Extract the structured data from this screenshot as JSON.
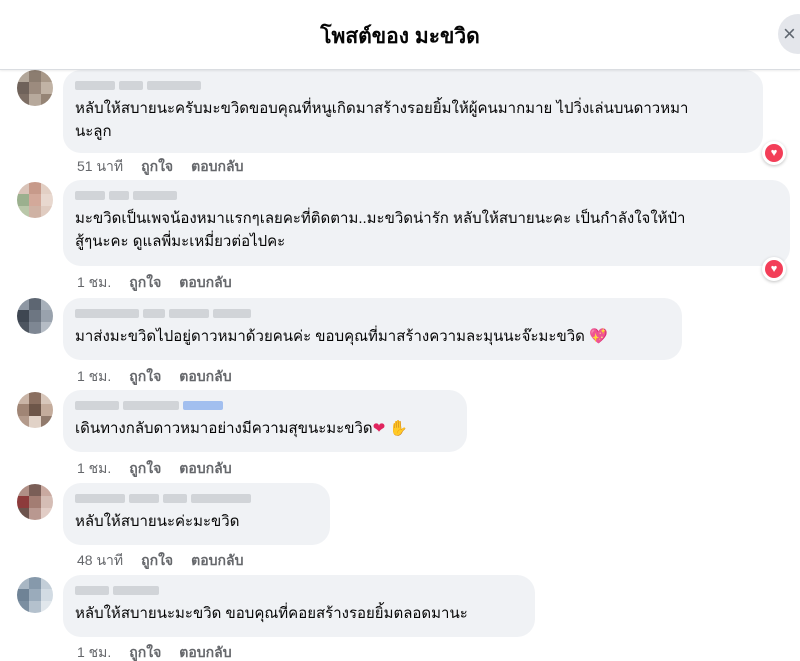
{
  "header": {
    "title": "โพสต์ของ มะขวิด",
    "close_icon": "×"
  },
  "comments": [
    {
      "text": "หลับให้สบายนะครับมะขวิดขอบคุณที่หนูเกิดมาสร้างรอยยิ้มให้ผู้คนมากมาย ไปวิ่งเล่นบนดาวหมา\nนะลูก",
      "time": "51 นาที",
      "like": "ถูกใจ",
      "reply": "ตอบกลับ",
      "reaction": "heart",
      "avatar_colors": [
        "#b3a79a",
        "#8c7d70",
        "#a89888",
        "#6f625a",
        "#9c8b7e",
        "#c1b3a5",
        "#7d6e64",
        "#b7a99c",
        "#958475"
      ]
    },
    {
      "text": "มะขวิดเป็นเพจน้องหมาแรกๆเลยคะที่ติดตาม..มะขวิดน่ารัก หลับให้สบายนะคะ เป็นกำลังใจให้ป๋า\nสู้ๆนะคะ ดูแลพี่มะเหมี่ยวต่อไปคะ",
      "time": "1 ชม.",
      "like": "ถูกใจ",
      "reply": "ตอบกลับ",
      "reaction": "heart",
      "avatar_colors": [
        "#d9c3b8",
        "#c79a8a",
        "#e2cfc4",
        "#9bb08e",
        "#d3a99a",
        "#e8d8cf",
        "#b9c7a9",
        "#cfb2a4",
        "#e0ccc1"
      ]
    },
    {
      "text": "มาส่งมะขวิดไปอยู่ดาวหมาด้วยคนค่ะ ขอบคุณที่มาสร้างความละมุนนะจ๊ะมะขวิด",
      "emoji": "💖",
      "time": "1 ชม.",
      "like": "ถูกใจ",
      "reply": "ตอบกลับ",
      "avatar_colors": [
        "#8e97a3",
        "#5d6672",
        "#a7b0ba",
        "#3f4752",
        "#6d7682",
        "#99a2ad",
        "#4d5560",
        "#7e8793",
        "#b5bcc5"
      ]
    },
    {
      "text": "เดินทางกลับดาวหมาอย่างมีความสุขนะมะขวิด",
      "emoji": "❤",
      "emoji2": "✋",
      "time": "1 ชม.",
      "like": "ถูกใจ",
      "reply": "ตอบกลับ",
      "avatar_colors": [
        "#c9b4a6",
        "#8a6f60",
        "#d8c7bb",
        "#a08575",
        "#6d5649",
        "#c4ac9c",
        "#b39a8b",
        "#e1d2c7",
        "#917a6c"
      ]
    },
    {
      "text": "หลับให้สบายนะค่ะมะขวิด",
      "time": "48 นาที",
      "like": "ถูกใจ",
      "reply": "ตอบกลับ",
      "avatar_colors": [
        "#b08f86",
        "#7a5e57",
        "#c9a9a0",
        "#8d3b3b",
        "#a37d73",
        "#d5bdb5",
        "#6c534c",
        "#b99890",
        "#e2cdc6"
      ]
    },
    {
      "text": "หลับให้สบายนะมะขวิด ขอบคุณที่คอยสร้างรอยยิ้มตลอดมานะ",
      "time": "1 ชม.",
      "like": "ถูกใจ",
      "reply": "ตอบกลับ",
      "avatar_colors": [
        "#a9b7c4",
        "#8699ab",
        "#c3ced8",
        "#6f8396",
        "#9aabbb",
        "#d2dbe3",
        "#7c8fa1",
        "#b4c1cd",
        "#e1e7ec"
      ]
    }
  ],
  "colors": {
    "bubble": "#f0f2f5",
    "meta_text": "#65676b",
    "heart": "#f33e58"
  }
}
